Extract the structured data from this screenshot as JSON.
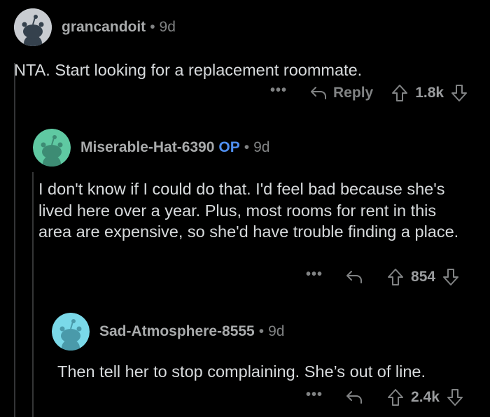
{
  "comments": [
    {
      "username": "grancandoit",
      "age": "9d",
      "op_badge": "",
      "body": "NTA. Start looking for a replacement roommate.",
      "reply_label": "Reply",
      "score": "1.8k",
      "more": "•••",
      "avatar_color": "#c9ccd1"
    },
    {
      "username": "Miserable-Hat-6390",
      "age": "9d",
      "op_badge": "OP",
      "body": "I don't know if I could do that. I'd feel bad because she's lived here over a year. Plus, most rooms for rent in this area are expensive, so she'd have trouble finding a place.",
      "reply_label": "",
      "score": "854",
      "more": "•••",
      "avatar_color": "#5fc9a2"
    },
    {
      "username": "Sad-Atmosphere-8555",
      "age": "9d",
      "op_badge": "",
      "body": "Then tell her to stop complaining. She’s out of line.",
      "reply_label": "",
      "score": "2.4k",
      "more": "•••",
      "avatar_color": "#7ad9e9"
    }
  ],
  "separator": "•",
  "colors": {
    "background": "#000000",
    "text": "#d7dadc",
    "meta": "#818384",
    "op": "#4f8ff0",
    "thread_line": "#343536"
  }
}
